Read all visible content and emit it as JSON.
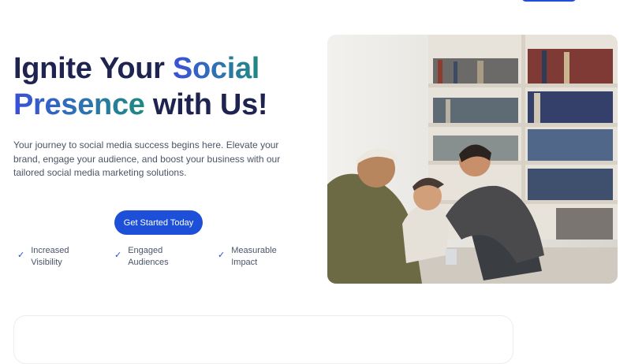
{
  "hero": {
    "title_line1_plain": "Ignite Your ",
    "title_line1_accent": "Social",
    "title_line2_accent": "Presence",
    "title_line2_plain": " with Us!",
    "description": "Your journey to social media success begins here. Elevate your brand, engage your audience, and boost your business with our tailored social media marketing solutions.",
    "cta_label": "Get Started Today"
  },
  "features": [
    {
      "icon": "check-icon",
      "label": "Increased Visibility"
    },
    {
      "icon": "check-icon",
      "label": "Engaged Audiences"
    },
    {
      "icon": "check-icon",
      "label": "Measurable Impact"
    }
  ],
  "colors": {
    "heading": "#1e2350",
    "accent_blue": "#3a4fd9",
    "accent_teal": "#1f8a7f",
    "button": "#1d4fd8"
  }
}
